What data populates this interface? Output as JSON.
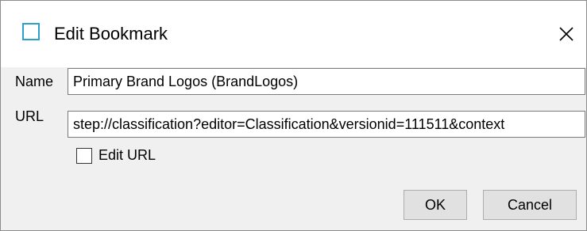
{
  "window": {
    "title": "Edit Bookmark",
    "icon": "bookmark-window-icon",
    "close_icon": "close-icon"
  },
  "form": {
    "name_label": "Name",
    "name_value": "Primary Brand Logos (BrandLogos)",
    "url_label": "URL",
    "url_value": "step://classification?editor=Classification&versionid=111511&context",
    "edit_url_label": "Edit URL",
    "edit_url_checked": false
  },
  "buttons": {
    "ok_label": "OK",
    "cancel_label": "Cancel"
  },
  "colors": {
    "accent": "#2ea0c8",
    "dialog_background": "#f0f0f0",
    "button_background": "#e1e1e1"
  }
}
